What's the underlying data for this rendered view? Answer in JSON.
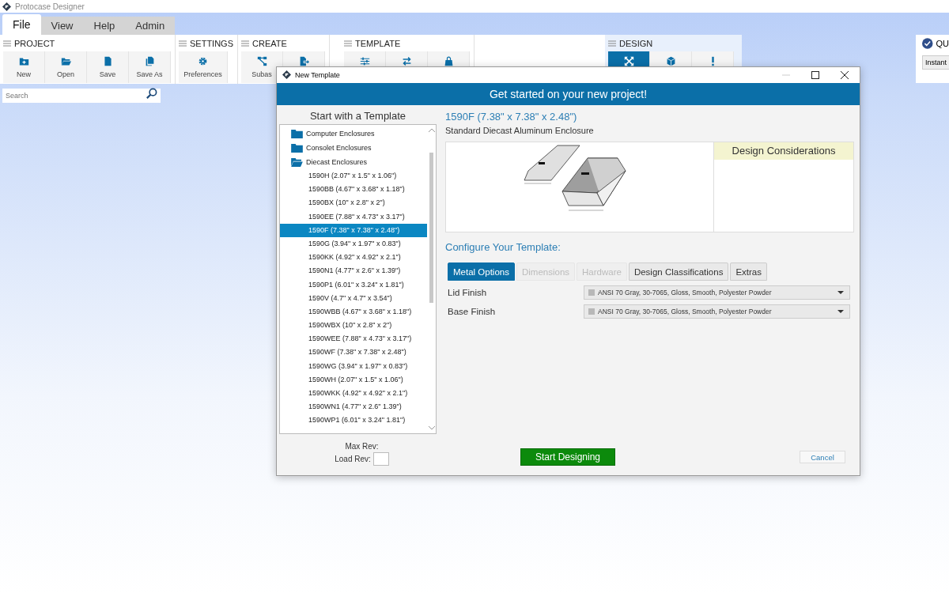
{
  "app": {
    "title": "Protocase Designer"
  },
  "menu_tabs": [
    {
      "label": "File",
      "selected": true
    },
    {
      "label": "View",
      "selected": false
    },
    {
      "label": "Help",
      "selected": false
    },
    {
      "label": "Admin",
      "selected": false
    }
  ],
  "ribbon_groups": [
    {
      "title": "PROJECT",
      "buttons": [
        {
          "label": "New",
          "selected": false
        },
        {
          "label": "Open",
          "selected": false
        },
        {
          "label": "Save",
          "selected": false
        },
        {
          "label": "Save As",
          "selected": false
        }
      ]
    },
    {
      "title": "SETTINGS",
      "buttons": [
        {
          "label": "Preferences",
          "selected": false
        }
      ]
    },
    {
      "title": "CREATE",
      "buttons": [
        {
          "label": "Subas",
          "selected": false
        },
        {
          "selected": false
        }
      ]
    },
    {
      "title": "TEMPLATE",
      "buttons": [
        {
          "selected": false
        },
        {
          "selected": false
        },
        {
          "selected": false
        }
      ]
    },
    {
      "title": "DESIGN",
      "buttons": [
        {
          "selected": true
        },
        {
          "selected": false
        },
        {
          "selected": false
        }
      ]
    }
  ],
  "search": {
    "placeholder": "Search"
  },
  "quote_panel": {
    "title": "QU",
    "button": "Instant"
  },
  "dialog": {
    "title": "New Template",
    "banner": "Get started on your new project!",
    "tree_title": "Start with a Template",
    "tree": [
      {
        "label": "Computer Enclosures",
        "expanded": false
      },
      {
        "label": "Consolet Enclosures",
        "expanded": false
      },
      {
        "label": "Diecast Enclosures",
        "expanded": true,
        "children": [
          {
            "label": "1590H (2.07\" x 1.5\" x 1.06\")",
            "selected": false
          },
          {
            "label": "1590BB (4.67\" x 3.68\" x 1.18\")",
            "selected": false
          },
          {
            "label": "1590BX (10\" x 2.8\" x 2\")",
            "selected": false
          },
          {
            "label": "1590EE (7.88\" x 4.73\" x 3.17\")",
            "selected": false
          },
          {
            "label": "1590F (7.38\" x 7.38\" x 2.48\")",
            "selected": true
          },
          {
            "label": "1590G (3.94\" x 1.97\" x 0.83\")",
            "selected": false
          },
          {
            "label": "1590KK (4.92\" x 4.92\" x 2.1\")",
            "selected": false
          },
          {
            "label": "1590N1 (4.77\" x 2.6\" x 1.39\")",
            "selected": false
          },
          {
            "label": "1590P1 (6.01\" x 3.24\" x 1.81\")",
            "selected": false
          },
          {
            "label": "1590V (4.7\" x 4.7\" x 3.54\")",
            "selected": false
          },
          {
            "label": "1590WBB (4.67\" x 3.68\" x 1.18\")",
            "selected": false
          },
          {
            "label": "1590WBX (10\" x 2.8\" x 2\")",
            "selected": false
          },
          {
            "label": "1590WEE (7.88\" x 4.73\" x 3.17\")",
            "selected": false
          },
          {
            "label": "1590WF (7.38\" x 7.38\" x 2.48\")",
            "selected": false
          },
          {
            "label": "1590WG (3.94\" x 1.97\" x 0.83\")",
            "selected": false
          },
          {
            "label": "1590WH (2.07\" x 1.5\" x 1.06\")",
            "selected": false
          },
          {
            "label": "1590WKK (4.92\" x 4.92\" x 2.1\")",
            "selected": false
          },
          {
            "label": "1590WN1 (4.77\" x 2.6\" 1.39\")",
            "selected": false
          },
          {
            "label": "1590WP1 (6.01\" x 3.24\" 1.81\")",
            "selected": false
          }
        ]
      }
    ],
    "max_rev_label": "Max Rev:",
    "load_rev_label": "Load Rev:",
    "template_name": "1590F (7.38\" x 7.38\" x 2.48\")",
    "template_desc": "Standard Diecast Aluminum Enclosure",
    "design_considerations": "Design Considerations",
    "configure_title": "Configure Your Template:",
    "tabs": [
      {
        "label": "Metal Options",
        "selected": true,
        "disabled": false
      },
      {
        "label": "Dimensions",
        "selected": false,
        "disabled": true
      },
      {
        "label": "Hardware",
        "selected": false,
        "disabled": true
      },
      {
        "label": "Design Classifications",
        "selected": false,
        "disabled": false
      },
      {
        "label": "Extras",
        "selected": false,
        "disabled": false
      }
    ],
    "fields": [
      {
        "label": "Lid Finish",
        "value": "ANSI 70 Gray, 30-7065, Gloss, Smooth, Polyester Powder"
      },
      {
        "label": "Base Finish",
        "value": "ANSI 70 Gray, 30-7065, Gloss, Smooth, Polyester Powder"
      }
    ],
    "start_button": "Start Designing",
    "cancel_button": "Cancel"
  }
}
